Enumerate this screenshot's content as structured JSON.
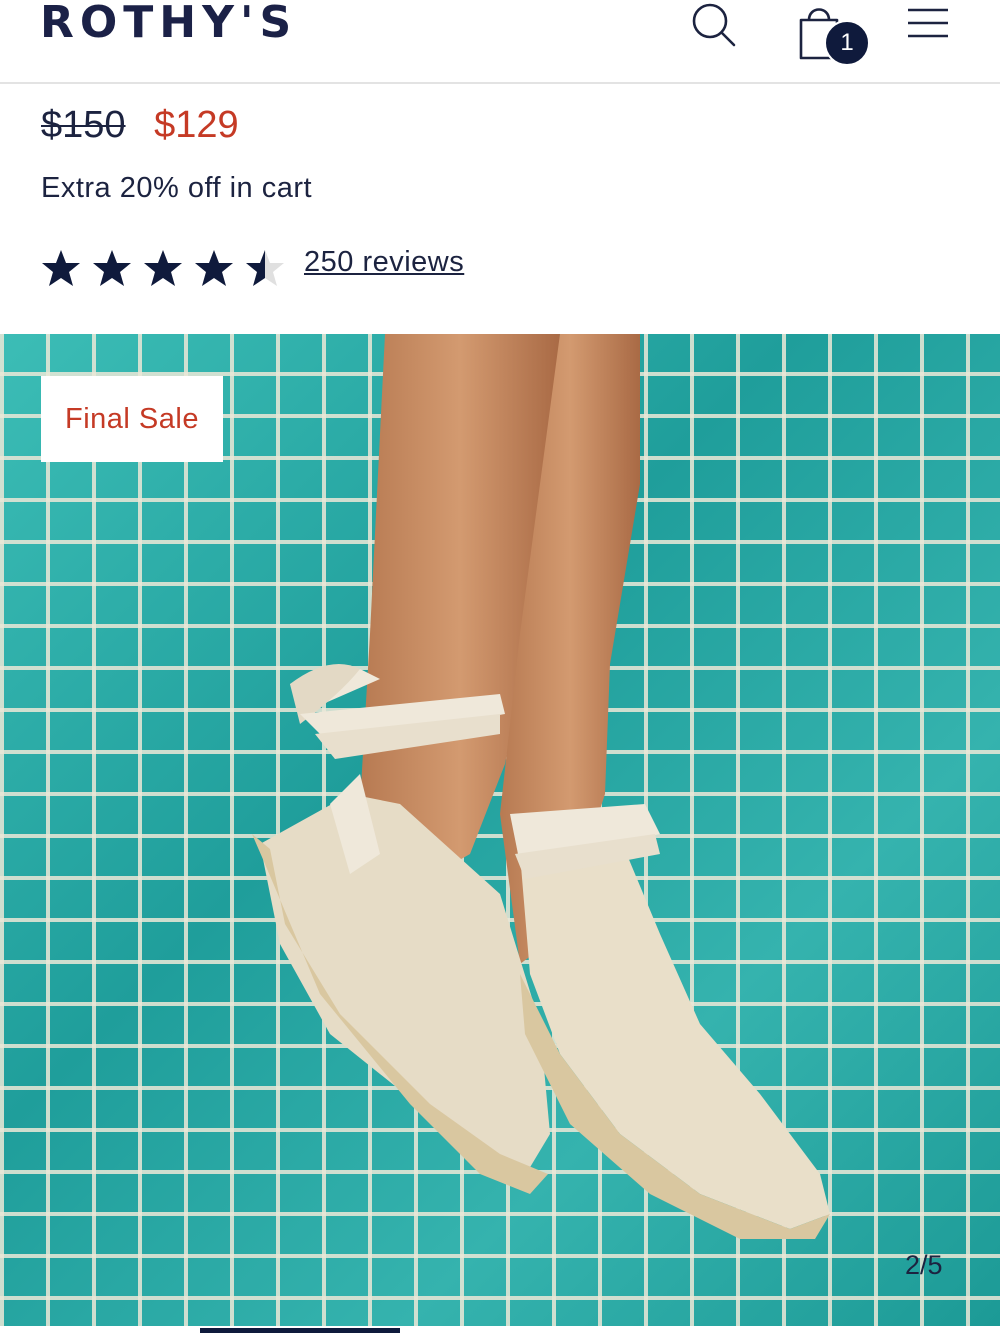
{
  "header": {
    "logo": "ROTHY'S",
    "cart_count": "1",
    "icons": [
      "search-icon",
      "shopping-bag-icon",
      "hamburger-menu-icon"
    ]
  },
  "product": {
    "price_original": "$150",
    "price_sale": "$129",
    "promo": "Extra 20% off in cart",
    "rating": 4.5,
    "rating_max": 5,
    "reviews_label": "250 reviews"
  },
  "gallery": {
    "badge": "Final Sale",
    "counter": "2/5",
    "current_index": 2,
    "total": 5
  },
  "colors": {
    "brand_navy": "#1b2147",
    "sale_red": "#c53a25",
    "tile_teal": "#2aa6a1"
  }
}
